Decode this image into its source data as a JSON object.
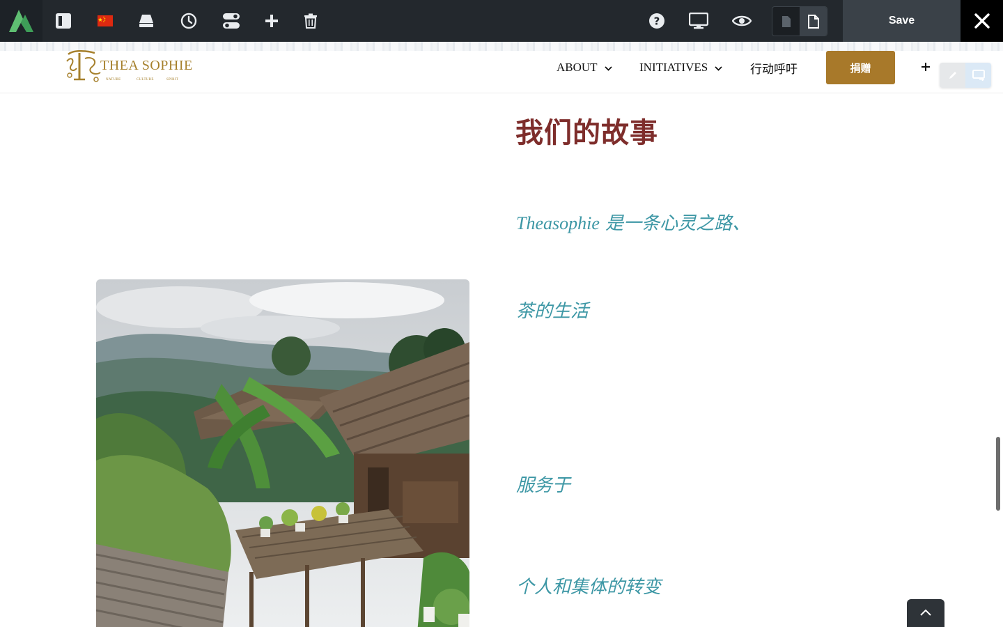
{
  "toolbar": {
    "logo_icon": "avada-logo-icon",
    "buttons": [
      {
        "name": "sidebar-toggle-icon"
      },
      {
        "name": "china-flag-icon"
      },
      {
        "name": "eraser-icon"
      },
      {
        "name": "clock-history-icon"
      },
      {
        "name": "toggles-icon"
      },
      {
        "name": "plus-icon"
      },
      {
        "name": "trash-icon"
      }
    ],
    "right_buttons": [
      {
        "name": "help-icon"
      },
      {
        "name": "desktop-preview-icon"
      },
      {
        "name": "eye-preview-icon"
      }
    ],
    "save_label": "Save"
  },
  "site": {
    "logo": {
      "text": "THEA SOPHIE",
      "tagline": [
        "NATURE",
        "CULTURE",
        "SPIRIT"
      ],
      "color": "#a6802c"
    },
    "nav": [
      {
        "label": "ABOUT",
        "has_dropdown": true
      },
      {
        "label": "INITIATIVES",
        "has_dropdown": true
      },
      {
        "label": "行动呼吁",
        "has_dropdown": false
      }
    ],
    "donate_label": "捐赠",
    "accent": "#a8792a"
  },
  "content": {
    "heading": "我们的故事",
    "heading_color": "#7e2d2b",
    "intro_latin": "Theasophie",
    "intro_rest": " 是一条心灵之路、",
    "line2": "茶的生活",
    "line3": "服务于",
    "line4": "个人和集体的转变",
    "text_color": "#3d97a5",
    "image": "mountain-village-photo"
  }
}
